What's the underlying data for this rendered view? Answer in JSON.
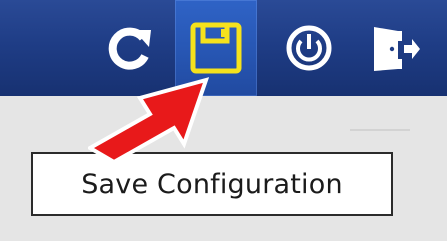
{
  "toolbar": {
    "buttons": [
      {
        "name": "refresh",
        "icon": "refresh-icon"
      },
      {
        "name": "save-configuration",
        "icon": "floppy-disk-icon",
        "state": "hover"
      },
      {
        "name": "power",
        "icon": "power-icon"
      },
      {
        "name": "logout",
        "icon": "exit-door-icon"
      }
    ],
    "colors": {
      "bar": "#1f3d86",
      "hover": "#2756b3",
      "save_icon": "#f5e21c",
      "icon_white": "#ffffff"
    }
  },
  "tooltip": {
    "text": "Save Configuration"
  },
  "annotation": {
    "icon": "red-arrow-icon",
    "color": "#e8191a"
  }
}
